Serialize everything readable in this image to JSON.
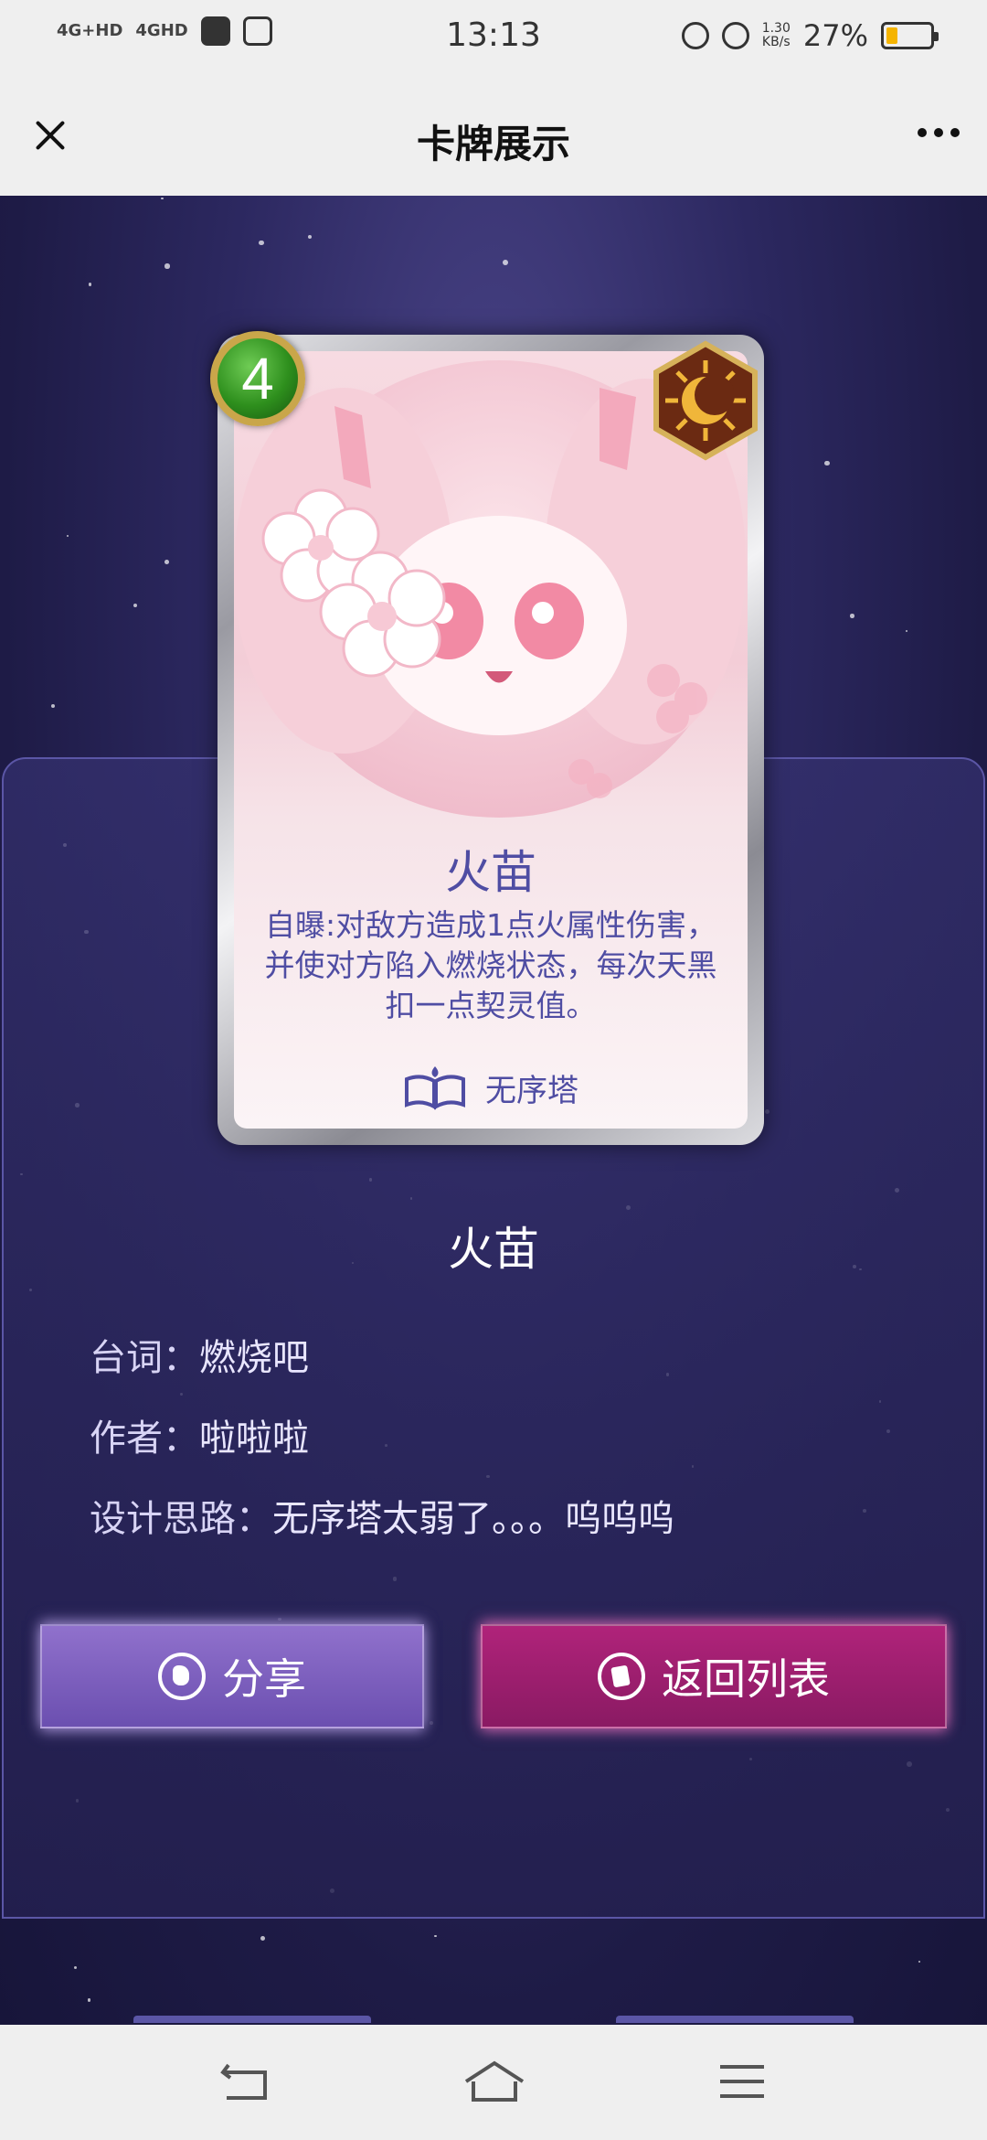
{
  "status_bar": {
    "signal_1": "4G+HD",
    "signal_2": "4GHD",
    "time": "13:13",
    "net_speed_value": "1.30",
    "net_speed_unit": "KB/s",
    "battery_percent": "27%",
    "battery_level": 0.27,
    "battery_color": "#f5b400"
  },
  "nav": {
    "title": "卡牌展示",
    "close_icon": "close-icon",
    "more_icon": "more-dots-icon"
  },
  "card": {
    "cost": "4",
    "name": "火苗",
    "description": "自曝:对敌方造成1点火属性伤害，并使对方陷入燃烧状态，每次天黑扣一点契灵值。",
    "faction": "无序塔",
    "badge_icon": "moon-sun-badge-icon",
    "faction_icon": "book-icon"
  },
  "info": {
    "name": "火苗",
    "line_label": "台词：",
    "line_value": "燃烧吧",
    "author_label": "作者：",
    "author_value": "啦啦啦",
    "design_label": "设计思路：",
    "design_value": "无序塔太弱了。。。呜呜呜"
  },
  "buttons": {
    "share_label": "分享",
    "back_label": "返回列表",
    "share_color": "#7a5cbd",
    "back_color": "#9c1f6e"
  },
  "colors": {
    "background": "#2c2860",
    "card_text": "#4f4da3",
    "nav_bg": "#efefef"
  }
}
